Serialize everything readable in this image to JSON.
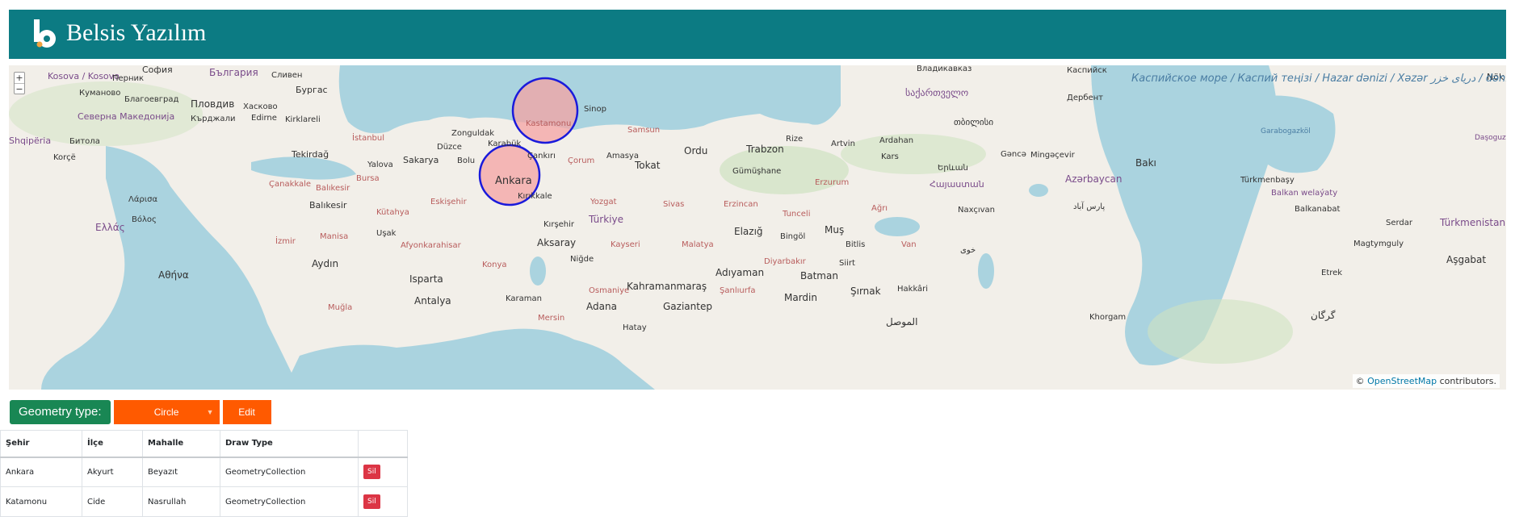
{
  "header": {
    "logo_letter": "b",
    "brand": "Belsis Yazılım",
    "color": "#0c7b83"
  },
  "map": {
    "zoom_in": "+",
    "zoom_out": "−",
    "labels": {
      "sofia": "София",
      "bulgaria": "България",
      "kosovo": "Kosova / Kosovo",
      "pernik": "Перник",
      "sliven": "Сливен",
      "burgas": "Бургас",
      "kumanovo": "Куманово",
      "plovdiv": "Пловдив",
      "haskovo": "Хасково",
      "blagoevgrad": "Благоевград",
      "kardzhali": "Кърджали",
      "edirne": "Edirne",
      "kirklareli": "Kirklareli",
      "north_macedonia": "Северна Македонија",
      "bitola": "Битола",
      "shqiperia": "Shqipëria",
      "istanbul": "İstanbul",
      "zonguldak": "Zonguldak",
      "karabuk": "Karabük",
      "duzce": "Düzce",
      "bolu": "Bolu",
      "sakarya": "Sakarya",
      "yalova": "Yalova",
      "bursa": "Bursa",
      "tekirdag": "Tekirdağ",
      "canakkale": "Çanakkale",
      "balikesir_prov": "Balıkesir",
      "balikesir": "Balıkesir",
      "eskisehir": "Eskişehir",
      "kutahya": "Kütahya",
      "manisa": "Manisa",
      "usak": "Uşak",
      "izmir": "İzmir",
      "afyon": "Afyonkarahisar",
      "aydin": "Aydın",
      "isparta": "Isparta",
      "antalya": "Antalya",
      "mugla": "Muğla",
      "konya": "Konya",
      "aksaray": "Aksaray",
      "nigde": "Niğde",
      "karaman": "Karaman",
      "mersin": "Mersin",
      "adana": "Adana",
      "osmaniye": "Osmaniye",
      "hatay": "Hatay",
      "gaziantep": "Gaziantep",
      "kahramanmaras": "Kahramanmaraş",
      "adiyaman": "Adıyaman",
      "sanliurfa": "Şanlıurfa",
      "malatya": "Malatya",
      "kayseri": "Kayseri",
      "sivas": "Sivas",
      "yozgat": "Yozgat",
      "kirsehir": "Kırşehir",
      "kirikkale": "Kırıkkale",
      "ankara": "Ankara",
      "turkiye": "Türkiye",
      "corum": "Çorum",
      "cankiri": "Çankırı",
      "kastamonu": "Kastamonu",
      "sinop": "Sinop",
      "samsun": "Samsun",
      "amasya": "Amasya",
      "tokat": "Tokat",
      "ordu": "Ordu",
      "trabzon": "Trabzon",
      "rize": "Rize",
      "gumushane": "Gümüşhane",
      "erzincan": "Erzincan",
      "erzurum": "Erzurum",
      "elazig": "Elazığ",
      "tunceli": "Tunceli",
      "bingol": "Bingöl",
      "mus": "Muş",
      "bitlis": "Bitlis",
      "diyarbakir": "Diyarbakır",
      "batman": "Batman",
      "siirt": "Siirt",
      "mardin": "Mardin",
      "sirnak": "Şırnak",
      "hakkari": "Hakkâri",
      "van": "Van",
      "agri": "Ağrı",
      "kars": "Kars",
      "ardahan": "Ardahan",
      "artvin": "Artvin",
      "greece": "Ελλάς",
      "athens": "Αθήνα",
      "larisa": "Λάρισα",
      "volos": "Βόλος",
      "kastoria": "Korçë",
      "georgia": "საქართველო",
      "tbilisi": "თბილისი",
      "vladikavkaz": "Владикавказ",
      "kaspiysk": "Каспийск",
      "derbent": "Дербент",
      "caspian": "Каспийское море / Каспий тeңізі / Hazar dənizi / Xəzər دریای خزر / dənizi/Caspian Sea",
      "azerbaycan": "Azərbaycan",
      "baku": "Bakı",
      "ganca": "Gəncə",
      "mingachevir": "Mingəçevir",
      "armenia": "Հայաստան",
      "yerevan": "Երևան",
      "nakhchivan": "Naxçıvan",
      "iran": "پارس آباد",
      "tabriz": "خوی",
      "turkmenbasy": "Türkmenbaşy",
      "balkanabat": "Balkanabat",
      "serdar": "Serdar",
      "turkmenistan": "Türkmenistan",
      "magtymguly": "Magtymguly",
      "ashgabat": "Aşgabat",
      "etrek": "Etrek",
      "gorgan": "گرگان",
      "mosul": "الموصل",
      "khorgam": "Khorgam",
      "garabogaz": "Garabogazköl",
      "balkan": "Balkan welaýaty",
      "dasoguz": "Daşoguz welaýaty",
      "nok": "Nök"
    },
    "attribution_prefix": "©",
    "attribution_link": "OpenStreetMap",
    "attribution_suffix": " contributors."
  },
  "controls": {
    "label": "Geometry type:",
    "selected": "Circle",
    "edit": "Edit",
    "label_color": "#198754",
    "accent_color": "#ff5a00"
  },
  "table": {
    "headers": [
      "Şehir",
      "İlçe",
      "Mahalle",
      "Draw Type",
      ""
    ],
    "rows": [
      {
        "sehir": "Ankara",
        "ilce": "Akyurt",
        "mahalle": "Beyazıt",
        "draw_type": "GeometryCollection",
        "action": "Sil"
      },
      {
        "sehir": "Katamonu",
        "ilce": "Cide",
        "mahalle": "Nasrullah",
        "draw_type": "GeometryCollection",
        "action": "Sil"
      }
    ]
  }
}
